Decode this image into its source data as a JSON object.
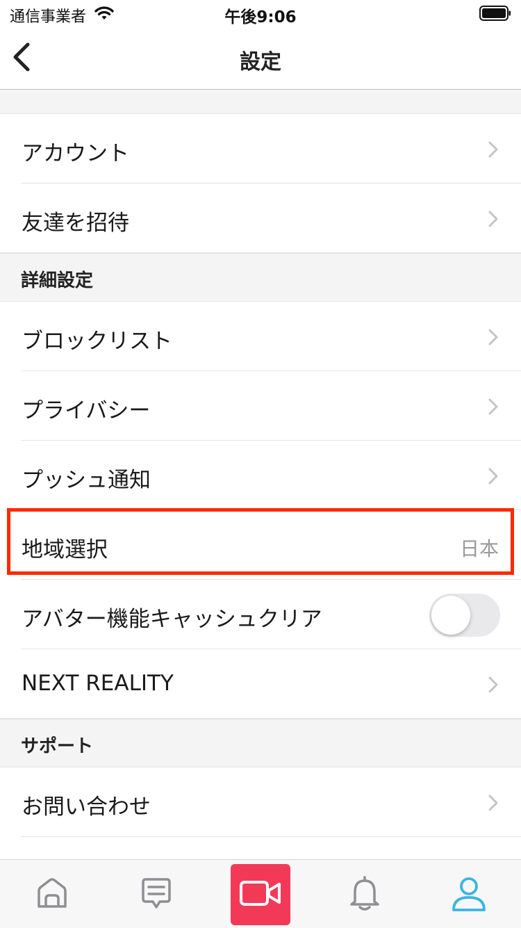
{
  "status_bar": {
    "carrier": "通信事業者",
    "time": "午後9:06"
  },
  "nav": {
    "title": "設定"
  },
  "rows_top": [
    {
      "label": "アカウント"
    },
    {
      "label": "友達を招待"
    }
  ],
  "section_advanced": {
    "title": "詳細設定"
  },
  "rows_advanced": [
    {
      "label": "ブロックリスト"
    },
    {
      "label": "プライバシー"
    },
    {
      "label": "プッシュ通知"
    },
    {
      "label": "地域選択",
      "value": "日本"
    },
    {
      "label": "アバター機能キャッシュクリア",
      "toggle": false
    },
    {
      "label": "NEXT REALITY"
    }
  ],
  "section_support": {
    "title": "サポート"
  },
  "rows_support": [
    {
      "label": "お問い合わせ"
    }
  ],
  "tabbar": {
    "items": [
      {
        "icon": "home-icon"
      },
      {
        "icon": "chat-icon"
      },
      {
        "icon": "video-camera-icon"
      },
      {
        "icon": "bell-icon"
      },
      {
        "icon": "profile-icon",
        "active": true
      }
    ],
    "active_color": "#3bb4e3",
    "record_color": "#f23a58"
  },
  "colors": {
    "highlight": "#ff2a00"
  }
}
